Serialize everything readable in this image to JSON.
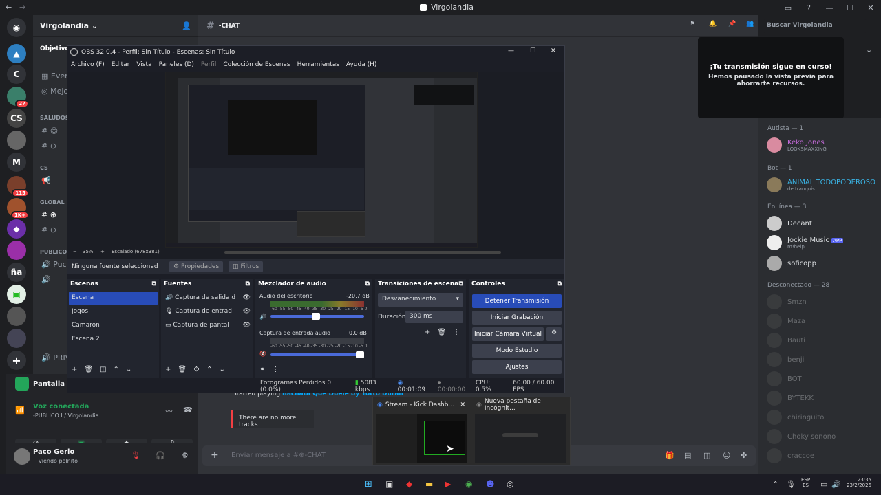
{
  "window": {
    "title": "Virgolandia"
  },
  "server": {
    "name": "Virgolandia"
  },
  "sidebar": {
    "banner": "Objetivo d",
    "items": [
      "Even",
      "Mejo"
    ],
    "categories": [
      "SALUDOS",
      "CS",
      "GLOBAL",
      "PUBLICO"
    ],
    "channels_public": [
      "Pucl",
      "PRIV"
    ]
  },
  "voice": {
    "status": "Voz conectada",
    "sub": "-PUBLICO I / Virgolandia",
    "stream_label": "Pantalla 1"
  },
  "user": {
    "name": "Paco Gerlo",
    "status": "viendo polnito"
  },
  "chat": {
    "channel": "-CHAT",
    "placeholder": "Enviar mensaje a #⊕-CHAT",
    "message_text": "Started playing",
    "message_link": "Bachata Que Duele by Yotto Duran",
    "no_tracks": "There are no more tracks"
  },
  "search": {
    "placeholder": "Buscar Virgolandia"
  },
  "notice": {
    "title": "¡Tu transmisión sigue en curso!",
    "body": "Hemos pausado la vista previa para ahorrarte recursos."
  },
  "members": {
    "groups": [
      "Autista — 1",
      "Bot — 1",
      "En línea — 3",
      "Desconectado — 28"
    ],
    "autista": {
      "name": "Keko Jones",
      "sub": "LOOKSMAXXING"
    },
    "bot": {
      "name": "ANIMAL TODOPODEROSO",
      "sub": "de tranquis"
    },
    "online": [
      {
        "name": "Decant",
        "sub": ""
      },
      {
        "name": "Jockie Music",
        "sub": "m!help",
        "tag": "APP"
      },
      {
        "name": "soficopp",
        "sub": ""
      }
    ],
    "offline": [
      "Smzn",
      "Maza",
      "Bauti",
      "benji",
      "BOT",
      "BYTEKK",
      "chiringuito",
      "Choky sonono",
      "craccoe"
    ]
  },
  "obs": {
    "title": "OBS 32.0.4 - Perfil: Sin Título - Escenas: Sin Título",
    "menu": [
      "Archivo (F)",
      "Editar",
      "Vista",
      "Paneles (D)",
      "Perfil",
      "Colección de Escenas",
      "Herramientas",
      "Ayuda (H)"
    ],
    "zoom": "35%",
    "scaled": "Escalado (678x381)",
    "no_source": "Ninguna fuente seleccionad",
    "props": "Propiedades",
    "filters": "Filtros",
    "docks": {
      "scenes": {
        "title": "Escenas",
        "items": [
          "Escena",
          "Jogos",
          "Camaron",
          "Escena 2"
        ]
      },
      "sources": {
        "title": "Fuentes",
        "items": [
          "Captura de salida d",
          "Captura de entrad",
          "Captura de pantal"
        ]
      },
      "mixer": {
        "title": "Mezclador de audio",
        "ch1": "Audio del escritorio",
        "ch1db": "-20.7 dB",
        "ch2": "Captura de entrada audio",
        "ch2db": "0.0 dB",
        "scale": "-60 -55 -50 -45 -40 -35 -30 -25 -20 -15 -10 -5 0"
      },
      "transitions": {
        "title": "Transiciones de escena",
        "type": "Desvanecimiento",
        "duration_label": "Duración",
        "duration": "300 ms"
      },
      "controls": {
        "title": "Controles",
        "stop": "Detener Transmisión",
        "record": "Iniciar Grabación",
        "vcam": "Iniciar Cámara Virtual",
        "studio": "Modo Estudio",
        "settings": "Ajustes"
      }
    },
    "status": {
      "frames": "Fotogramas Perdidos 0 (0.0%)",
      "kbps": "5083 kbps",
      "stream_time": "00:01:09",
      "rec_time": "00:00:00",
      "cpu": "CPU: 0.5%",
      "fps": "60.00 / 60.00 FPS"
    }
  },
  "taskbar_previews": [
    {
      "title": "Stream - Kick Dashb..."
    },
    {
      "title": "Nueva pestaña de Incógnit..."
    }
  ],
  "tray": {
    "lang1": "ESP",
    "lang2": "ES",
    "time": "23:35",
    "date": "23/2/2026"
  },
  "colors": {
    "accent": "#5865f2",
    "obs_bg": "#1c1e26",
    "obs_btn": "#3c404d",
    "obs_active": "#284cb8"
  }
}
